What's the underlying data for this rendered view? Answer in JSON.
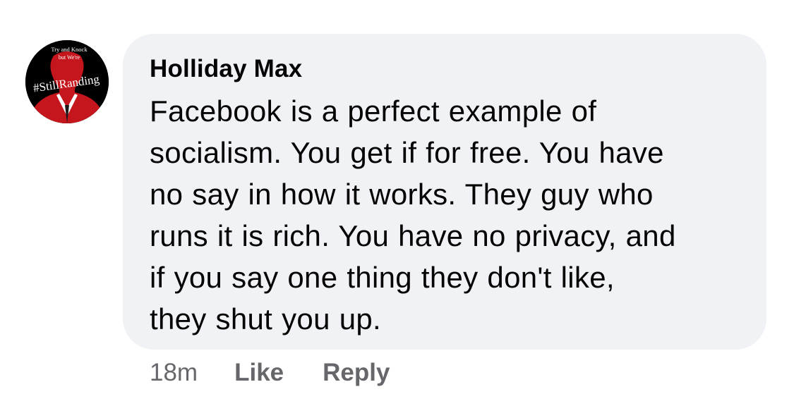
{
  "avatar": {
    "top_text_1": "Try and Knock",
    "top_text_2": "but We're",
    "overlay_text": "#StillRanding",
    "colors": {
      "background": "#000000",
      "figure": "#c4161c",
      "shirt": "#ffffff"
    }
  },
  "comment": {
    "author": "Holliday Max",
    "lines": [
      "Facebook is a perfect example of",
      "socialism. You get if for free. You have",
      "no say in how it works. They guy who",
      "runs it is rich. You have no privacy, and",
      "if you say one thing they don't like,",
      "they shut you up."
    ]
  },
  "actions": {
    "time": "18m",
    "like_label": "Like",
    "reply_label": "Reply"
  },
  "colors": {
    "bubble_bg": "#f0f2f5",
    "text": "#050505",
    "meta_text": "#65676b"
  }
}
